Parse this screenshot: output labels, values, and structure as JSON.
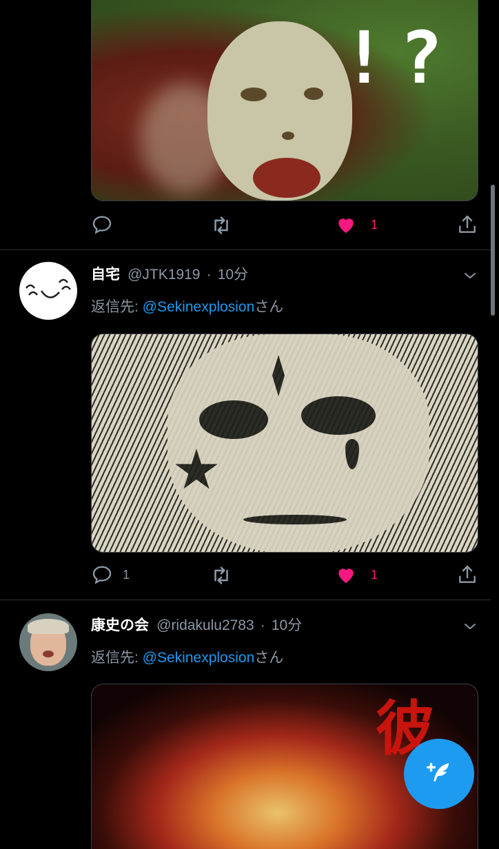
{
  "colors": {
    "background": "#000000",
    "accent": "#1d9bf0",
    "like": "#f91880",
    "secondary_text": "#8b98a5",
    "divider": "#2f3336"
  },
  "tweet0": {
    "image_overlay_text": "!?",
    "actions": {
      "reply_count": "",
      "retweet_count": "",
      "like_count": "1",
      "like_active": true
    }
  },
  "tweet1": {
    "display_name": "自宅",
    "handle": "@JTK1919",
    "separator": "·",
    "time": "10分",
    "reply_prefix": "返信先: ",
    "reply_to": "@Sekinexplosion",
    "reply_suffix": "さん",
    "actions": {
      "reply_count": "1",
      "retweet_count": "",
      "like_count": "1",
      "like_active": true
    }
  },
  "tweet2": {
    "display_name": "康史の会",
    "handle": "@ridakulu2783",
    "separator": "·",
    "time": "10分",
    "reply_prefix": "返信先: ",
    "reply_to": "@Sekinexplosion",
    "reply_suffix": "さん",
    "image_overlay_text": "彼"
  },
  "icons": [
    "reply-icon",
    "retweet-icon",
    "like-icon",
    "share-icon",
    "caret-down-icon",
    "compose-tweet-icon"
  ]
}
